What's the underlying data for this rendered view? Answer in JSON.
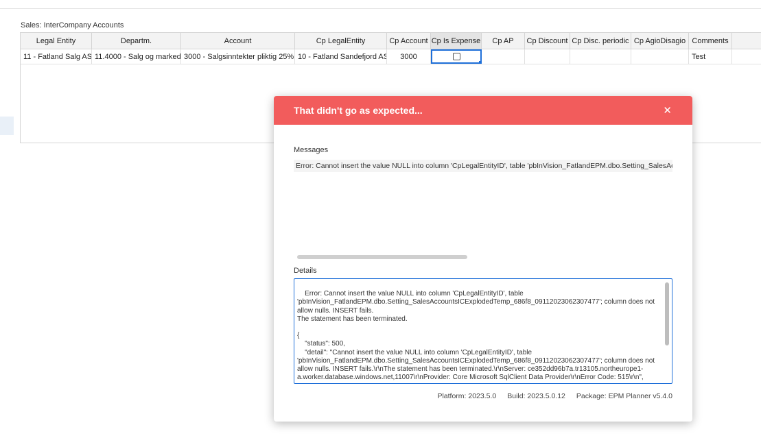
{
  "section_title": "Sales: InterCompany Accounts",
  "table": {
    "columns": [
      "Legal Entity",
      "Departm.",
      "Account",
      "Cp LegalEntity",
      "Cp Account",
      "Cp Is Expense",
      "Cp AP",
      "Cp Discount",
      "Cp Disc. periodic",
      "Cp AgioDisagio",
      "Comments",
      ""
    ],
    "rows": [
      [
        "11 - Fatland Salg AS",
        "11.4000 - Salg og marked",
        "3000 - Salgsinntekter pliktig 25%",
        "10 - Fatland Sandefjord AS",
        "3000",
        "",
        "",
        "",
        "",
        "",
        "Test",
        ""
      ]
    ],
    "checkbox_checked": false
  },
  "dialog": {
    "title": "That didn't go as expected...",
    "close_icon": "close-icon",
    "messages_label": "Messages",
    "message": "Error: Cannot insert the value NULL into column 'CpLegalEntityID', table 'pbInVision_FatlandEPM.dbo.Setting_SalesAccountsICExplodedTemp_686f8_09112023062307477'; column does not allow nulls. INSERT fails.",
    "details_label": "Details",
    "details": "Error: Cannot insert the value NULL into column 'CpLegalEntityID', table 'pbInVision_FatlandEPM.dbo.Setting_SalesAccountsICExplodedTemp_686f8_09112023062307477'; column does not allow nulls. INSERT fails.\nThe statement has been terminated.\n\n{\n    \"status\": 500,\n    \"detail\": \"Cannot insert the value NULL into column 'CpLegalEntityID', table 'pbInVision_FatlandEPM.dbo.Setting_SalesAccountsICExplodedTemp_686f8_09112023062307477'; column does not allow nulls. INSERT fails.\\r\\nThe statement has been terminated.\\r\\nServer: ce352dd96b7a.tr13105.northeurope1-a.worker.database.windows.net,11007\\r\\nProvider: Core Microsoft SqlClient Data Provider\\r\\nError Code: 515\\r\\n\",",
    "platform": "Platform: 2023.5.0",
    "build": "Build: 2023.5.0.12",
    "package": "Package: EPM Planner v5.4.0"
  }
}
